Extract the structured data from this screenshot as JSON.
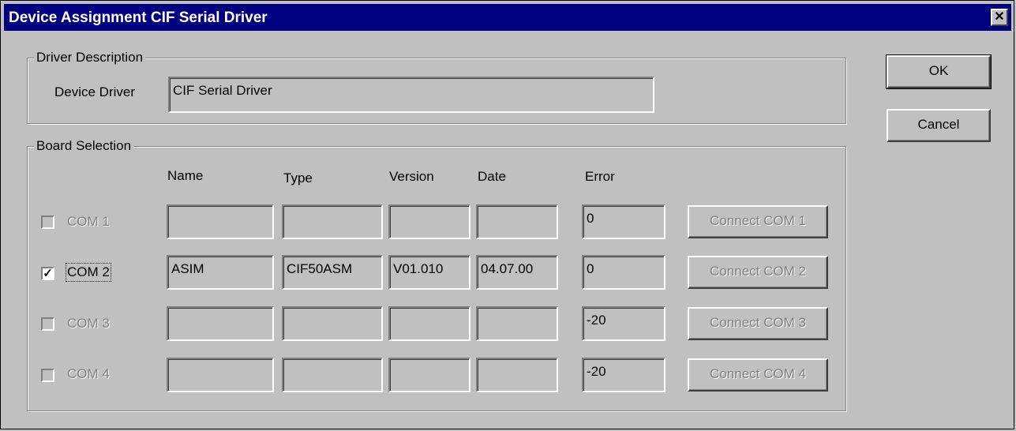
{
  "window": {
    "title": "Device Assignment CIF Serial Driver",
    "close_symbol": "✕"
  },
  "driver_description": {
    "group_label": "Driver Description",
    "device_driver_label": "Device Driver",
    "device_driver_value": "CIF Serial Driver"
  },
  "board_selection": {
    "group_label": "Board Selection",
    "columns": [
      "Name",
      "Type",
      "Version",
      "Date",
      "Error"
    ],
    "rows": [
      {
        "port": "COM 1",
        "checked": false,
        "enabled": false,
        "name": "",
        "type": "",
        "version": "",
        "date": "",
        "error": "0",
        "connect_label": "Connect COM 1"
      },
      {
        "port": "COM 2",
        "checked": true,
        "enabled": true,
        "name": "ASIM",
        "type": "CIF50ASM",
        "version": "V01.010",
        "date": "04.07.00",
        "error": "0",
        "connect_label": "Connect COM 2"
      },
      {
        "port": "COM 3",
        "checked": false,
        "enabled": false,
        "name": "",
        "type": "",
        "version": "",
        "date": "",
        "error": "-20",
        "connect_label": "Connect COM 3"
      },
      {
        "port": "COM 4",
        "checked": false,
        "enabled": false,
        "name": "",
        "type": "",
        "version": "",
        "date": "",
        "error": "-20",
        "connect_label": "Connect COM 4"
      }
    ]
  },
  "buttons": {
    "ok": "OK",
    "cancel": "Cancel"
  },
  "colors": {
    "title_bar": "#000080",
    "face": "#c0c0c0",
    "disabled_text": "#808080"
  }
}
